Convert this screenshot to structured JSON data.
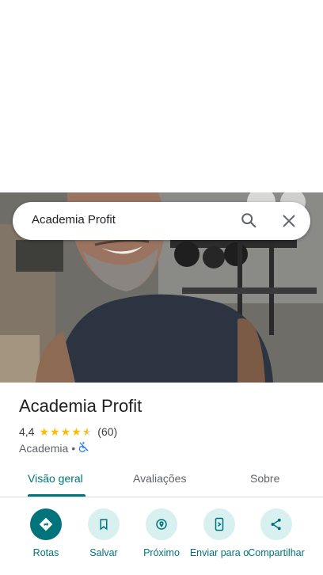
{
  "search": {
    "query": "Academia Profit"
  },
  "place": {
    "name": "Academia Profit",
    "rating": "4,4",
    "stars_value": 4.4,
    "review_count": "(60)",
    "category": "Academia",
    "separator": "•"
  },
  "tabs": [
    {
      "label": "Visão geral",
      "active": true
    },
    {
      "label": "Avaliações",
      "active": false
    },
    {
      "label": "Sobre",
      "active": false
    }
  ],
  "actions": [
    {
      "label": "Rotas",
      "icon": "directions-icon"
    },
    {
      "label": "Salvar",
      "icon": "bookmark-icon"
    },
    {
      "label": "Próximo",
      "icon": "nearby-icon"
    },
    {
      "label": "Enviar para o",
      "icon": "send-to-phone-icon"
    },
    {
      "label": "Compartilhar",
      "icon": "share-icon"
    }
  ],
  "colors": {
    "accent": "#00747a",
    "star": "#fbbc04",
    "action_bg": "#d9f0f0"
  }
}
